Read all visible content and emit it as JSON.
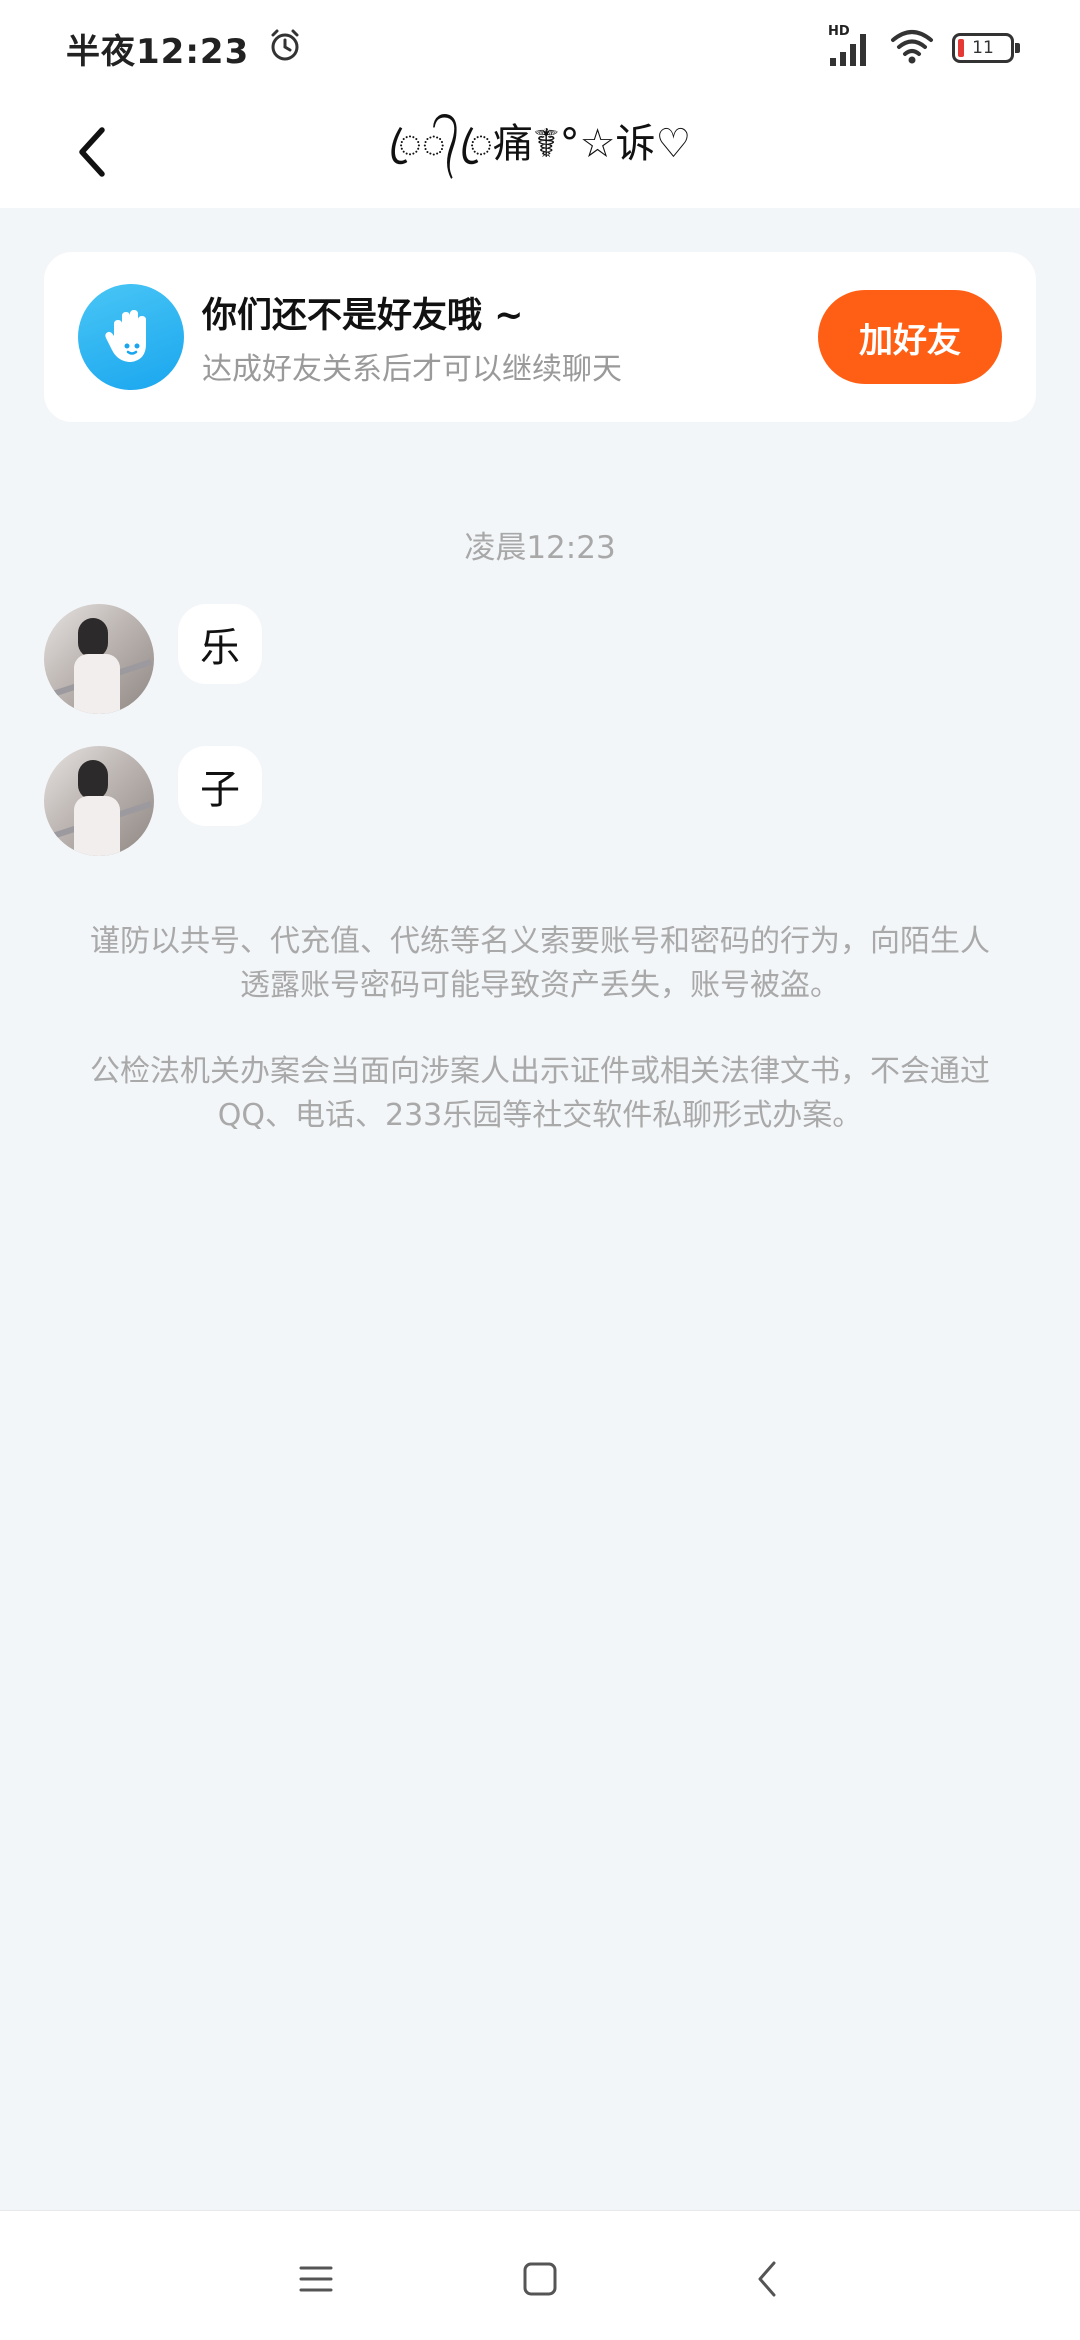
{
  "status_bar": {
    "time": "半夜12:23",
    "network_label": "HD",
    "battery_level": "11"
  },
  "header": {
    "title": "ꦿ᭄ꦿ痛☤°☆诉♡"
  },
  "friend_banner": {
    "title": "你们还不是好友哦 ~",
    "subtitle": "达成好友关系后才可以继续聊天",
    "add_button_label": "加好友"
  },
  "chat": {
    "timestamp": "凌晨12:23",
    "messages": [
      {
        "text": "乐"
      },
      {
        "text": "子"
      }
    ]
  },
  "notices": {
    "warning_1": "谨防以共号、代充值、代练等名义索要账号和密码的行为，向陌生人透露账号密码可能导致资产丢失，账号被盗。",
    "warning_2": "公检法机关办案会当面向涉案人出示证件或相关法律文书，不会通过QQ、电话、233乐园等社交软件私聊形式办案。"
  },
  "colors": {
    "accent": "#ff5f14",
    "background": "#f3f6f9",
    "icon_blue": "#29b0f2"
  },
  "icons": {
    "alarm": "alarm-icon",
    "signal": "signal-icon",
    "wifi": "wifi-icon",
    "battery": "battery-icon",
    "back": "back-arrow-icon",
    "hand": "hand-wave-icon",
    "nav_menu": "menu-icon",
    "nav_home": "home-square-icon",
    "nav_back": "nav-back-icon"
  }
}
